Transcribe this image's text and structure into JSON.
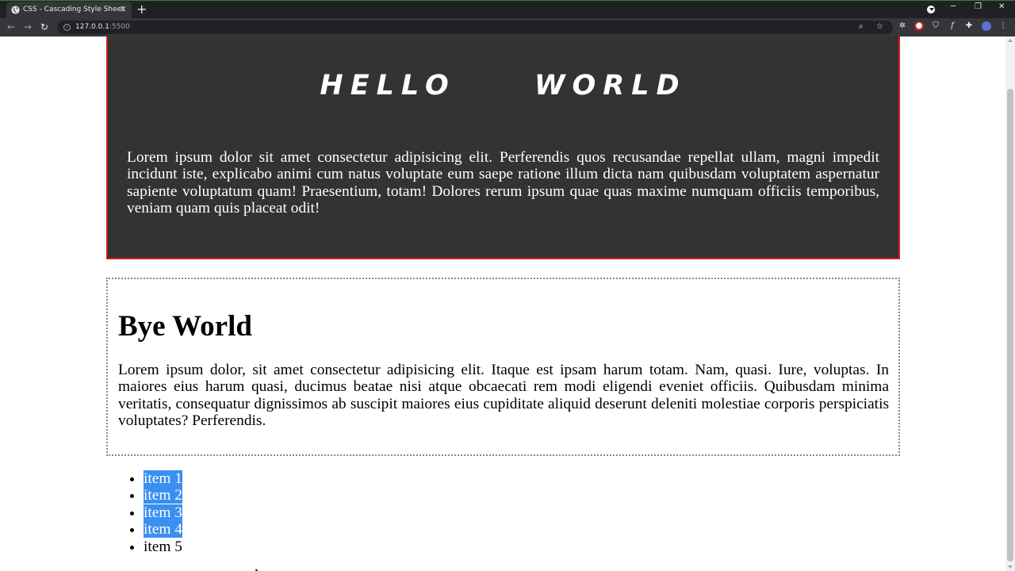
{
  "browser": {
    "tab_title": "CSS - Cascading Style Sheet",
    "new_tab_label": "+",
    "url_host": "127.0.0.1",
    "url_port": ":5500"
  },
  "page": {
    "hero": {
      "title": "HELLO WORLD",
      "paragraph": "Lorem ipsum dolor sit amet consectetur adipisicing elit. Perferendis quos recusandae repellat ullam, magni impedit incidunt iste, explicabo animi cum natus voluptate eum saepe ratione illum dicta nam quibusdam voluptatem aspernatur sapiente voluptatum quam! Praesentium, totam! Dolores rerum ipsum quae quas maxime numquam officiis temporibus, veniam quam quis placeat odit!"
    },
    "section": {
      "heading": "Bye World",
      "paragraph": "Lorem ipsum dolor, sit amet consectetur adipisicing elit. Itaque est ipsam harum totam. Nam, quasi. Iure, voluptas. In maiores eius harum quasi, ducimus beatae nisi atque obcaecati rem modi eligendi eveniet officiis. Quibusdam minima veritatis, consequatur dignissimos ab suscipit maiores eius cupiditate aliquid deserunt deleniti molestiae corporis perspiciatis voluptates? Perferendis."
    },
    "list": {
      "items": [
        "item 1",
        "item 2",
        "item 3",
        "item 4",
        "item 5"
      ],
      "selected_count": 4
    }
  },
  "colors": {
    "hero_bg": "#333333",
    "hero_border": "#d01b1b",
    "selection": "#3b8ff0"
  }
}
